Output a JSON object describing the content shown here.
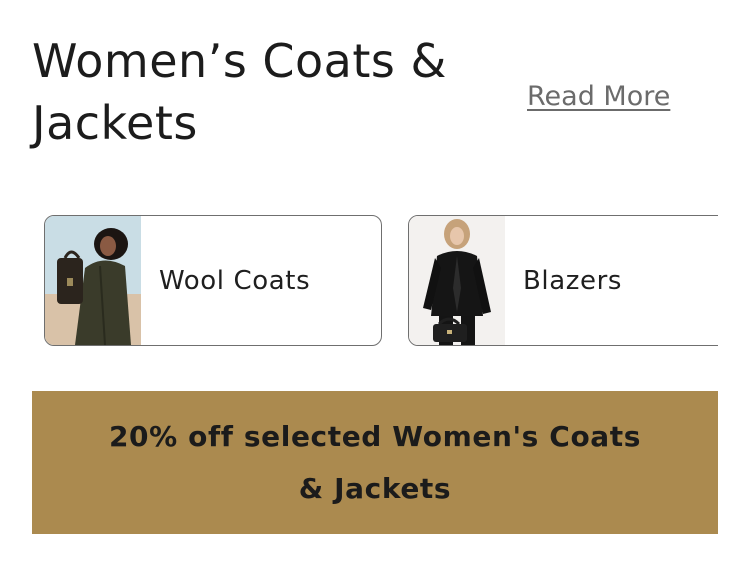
{
  "header": {
    "title": "Women’s Coats & Jackets",
    "read_more": "Read More"
  },
  "categories": [
    {
      "label": "Wool Coats",
      "image": "woman-in-dark-green-wool-coat-with-bag"
    },
    {
      "label": "Blazers",
      "image": "woman-in-black-blazer-suit"
    }
  ],
  "promo": {
    "text": "20% off selected Women's Coats & Jackets"
  },
  "colors": {
    "promo_background": "#ab8a4f",
    "text": "#1f1f1f",
    "link": "#6b6b6b",
    "card_border": "#6f6f6f"
  }
}
